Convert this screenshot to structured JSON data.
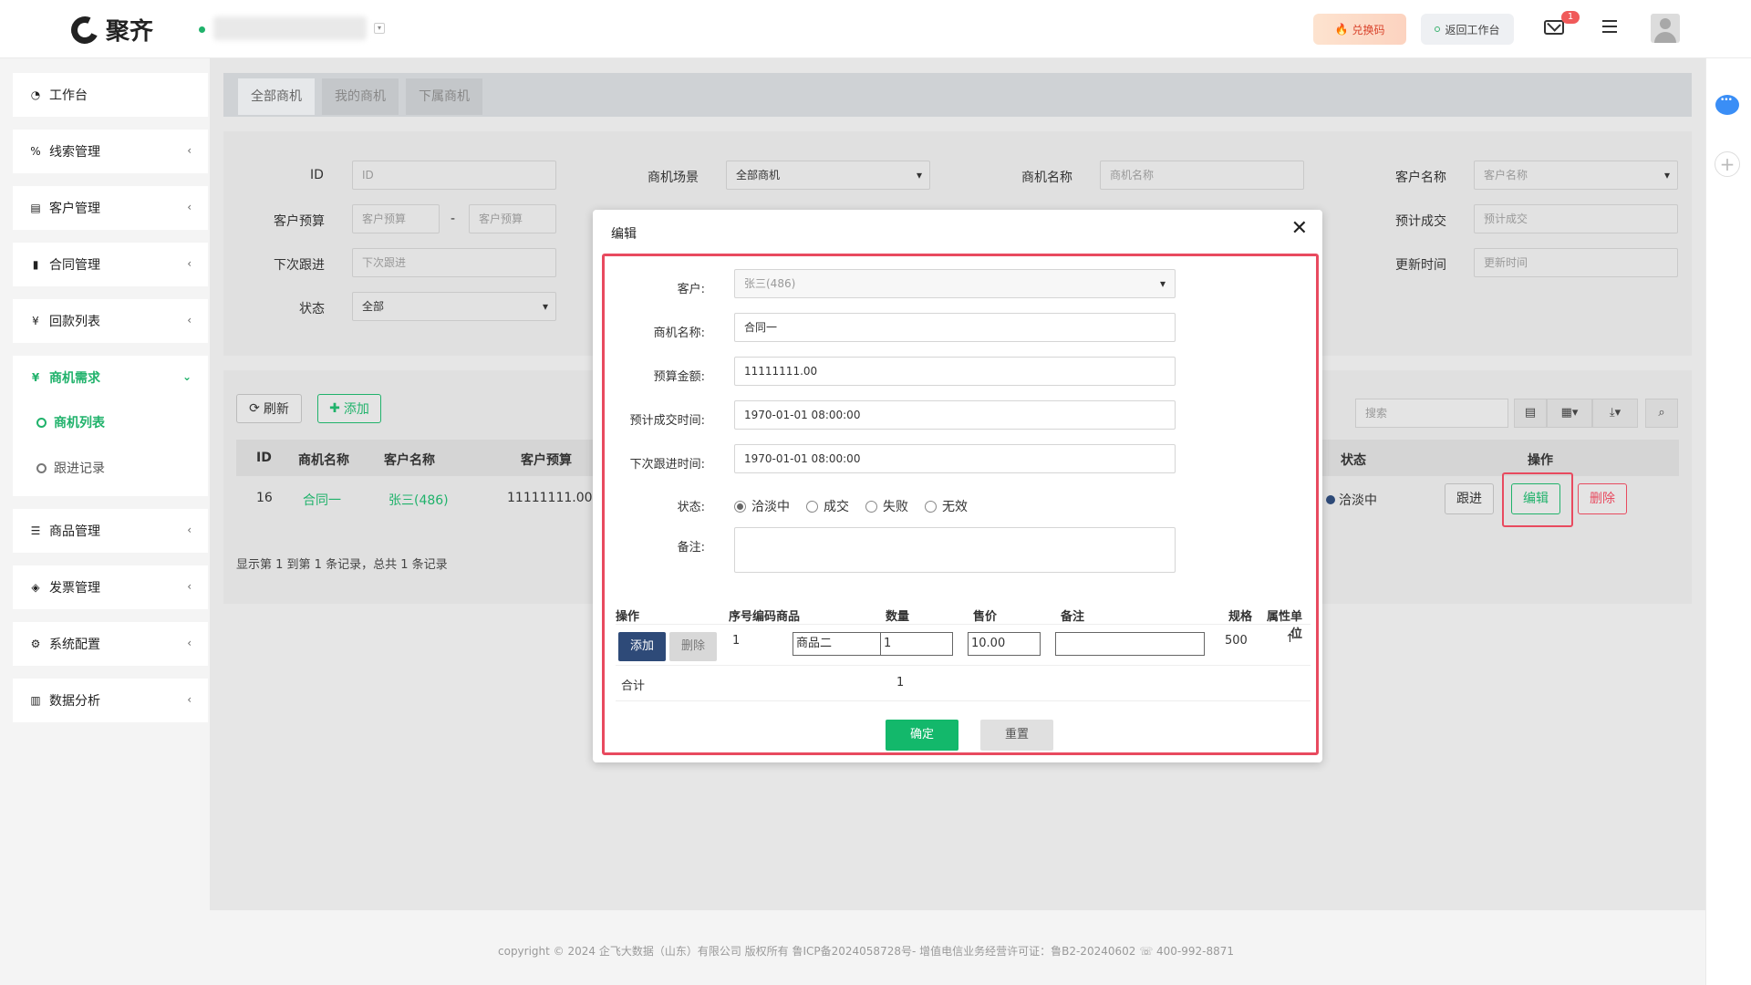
{
  "topbar": {
    "brand": "聚齐",
    "redeem_label": "兑换码",
    "back_label": "返回工作台",
    "mail_badge": "1"
  },
  "sidebar": {
    "items": [
      {
        "icon": "dashboard-icon",
        "label": "工作台"
      },
      {
        "icon": "link-icon",
        "label": "线索管理"
      },
      {
        "icon": "id-card-icon",
        "label": "客户管理"
      },
      {
        "icon": "bookmark-icon",
        "label": "合同管理"
      },
      {
        "icon": "yen-icon",
        "label": "回款列表"
      },
      {
        "icon": "yen-icon",
        "label": "商机需求"
      },
      {
        "icon": "list-icon",
        "label": "商品管理"
      },
      {
        "icon": "tag-icon",
        "label": "发票管理"
      },
      {
        "icon": "gears-icon",
        "label": "系统配置"
      },
      {
        "icon": "bar-chart-icon",
        "label": "数据分析"
      }
    ],
    "sub_items": [
      "商机列表",
      "跟进记录"
    ]
  },
  "tabs": [
    "全部商机",
    "我的商机",
    "下属商机"
  ],
  "filters": {
    "id_label": "ID",
    "id_placeholder": "ID",
    "scene_label": "商机场景",
    "scene_value": "全部商机",
    "name_label": "商机名称",
    "name_placeholder": "商机名称",
    "customer_label": "客户名称",
    "customer_placeholder": "客户名称",
    "budget_label": "客户预算",
    "budget_placeholder": "客户预算",
    "budget_sep": "-",
    "expected_label": "预计成交",
    "expected_placeholder": "预计成交",
    "next_label": "下次跟进",
    "next_placeholder": "下次跟进",
    "updated_label": "更新时间",
    "updated_placeholder": "更新时间",
    "status_label": "状态",
    "status_value": "全部"
  },
  "list": {
    "refresh_label": "刷新",
    "add_label": "添加",
    "search_placeholder": "搜索",
    "columns": {
      "id": "ID",
      "name": "商机名称",
      "customer": "客户名称",
      "budget": "客户预算",
      "status": "状态",
      "ops": "操作"
    },
    "row": {
      "id": "16",
      "name": "合同一",
      "customer": "张三(486)",
      "budget": "11111111.00",
      "status": "洽淡中"
    },
    "follow_label": "跟进",
    "edit_label": "编辑",
    "delete_label": "删除",
    "pager": "显示第 1 到第 1 条记录，总共 1 条记录"
  },
  "footer": {
    "text": "copyright © 2024 企飞大数据（山东）有限公司 版权所有   鲁ICP备2024058728号-   增值电信业务经营许可证：鲁B2-20240602 ☏ 400-992-8871"
  },
  "modal": {
    "title": "编辑",
    "customer_label": "客户:",
    "customer_value": "张三(486)",
    "name_label": "商机名称:",
    "name_value": "合同一",
    "budget_label": "预算金额:",
    "budget_value": "11111111.00",
    "expected_label": "预计成交时间:",
    "expected_value": "1970-01-01 08:00:00",
    "next_label": "下次跟进时间:",
    "next_value": "1970-01-01 08:00:00",
    "status_label": "状态:",
    "status_options": [
      "洽淡中",
      "成交",
      "失败",
      "无效"
    ],
    "status_selected": "洽淡中",
    "remark_label": "备注:",
    "products": {
      "headers": [
        "操作",
        "序号",
        "编码",
        "商品",
        "数量",
        "售价",
        "备注",
        "规格",
        "属性",
        "单位"
      ],
      "add_label": "添加",
      "delete_label": "删除",
      "row": {
        "seq": "1",
        "product": "商品二",
        "qty": "1",
        "price": "10.00",
        "spec": "500"
      },
      "sum_label": "合计",
      "sum_qty": "1"
    },
    "ok_label": "确定",
    "reset_label": "重置"
  },
  "colors": {
    "accent": "#20b26b",
    "highlight": "#e84a5f",
    "ok": "#13b86b"
  }
}
